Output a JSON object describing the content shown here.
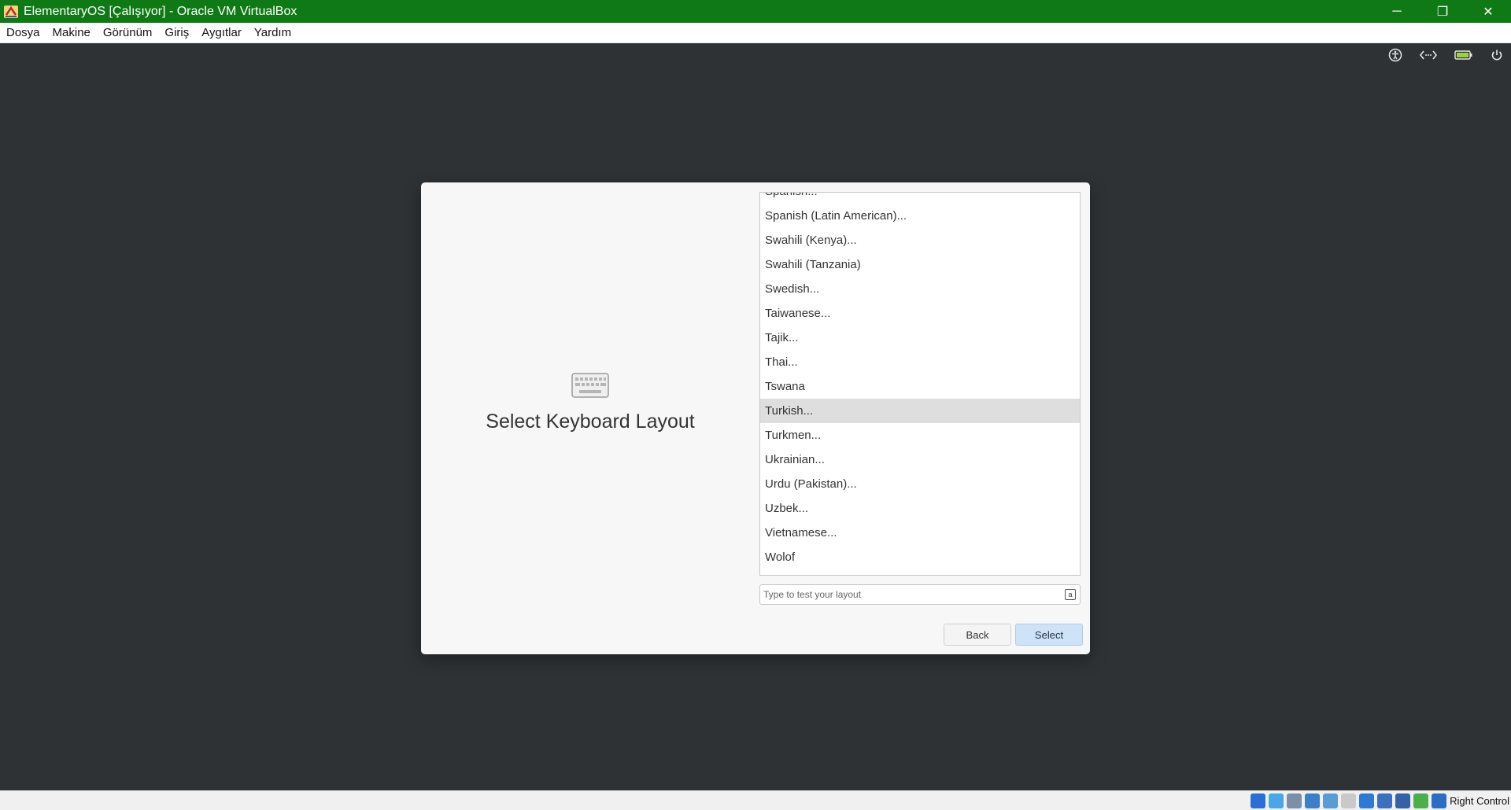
{
  "window": {
    "title": "ElementaryOS [Çalışıyor] - Oracle VM VirtualBox",
    "controls": {
      "minimize": "─",
      "restore": "❐",
      "close": "✕"
    }
  },
  "menu": {
    "items": [
      {
        "label": "Dosya"
      },
      {
        "label": "Makine"
      },
      {
        "label": "Görünüm"
      },
      {
        "label": "Giriş"
      },
      {
        "label": "Aygıtlar"
      },
      {
        "label": "Yardım"
      }
    ]
  },
  "guest_indicators": [
    "accessibility-icon",
    "network-icon",
    "battery-icon",
    "power-icon"
  ],
  "dialog": {
    "icon": "keyboard-icon",
    "title": "Select Keyboard Layout",
    "layouts": [
      {
        "label": "Spanish..."
      },
      {
        "label": "Spanish (Latin American)..."
      },
      {
        "label": "Swahili (Kenya)..."
      },
      {
        "label": "Swahili (Tanzania)"
      },
      {
        "label": "Swedish..."
      },
      {
        "label": "Taiwanese..."
      },
      {
        "label": "Tajik..."
      },
      {
        "label": "Thai..."
      },
      {
        "label": "Tswana"
      },
      {
        "label": "Turkish...",
        "selected": true
      },
      {
        "label": "Turkmen..."
      },
      {
        "label": "Ukrainian..."
      },
      {
        "label": "Urdu (Pakistan)..."
      },
      {
        "label": "Uzbek..."
      },
      {
        "label": "Vietnamese..."
      },
      {
        "label": "Wolof"
      }
    ],
    "test_input": {
      "placeholder": "Type to test your layout",
      "value": ""
    },
    "back_label": "Back",
    "select_label": "Select"
  },
  "statusbar": {
    "icons": [
      {
        "name": "hard-disk-icon",
        "color": "#2a6fd6"
      },
      {
        "name": "optical-drive-icon",
        "color": "#4aa6e6"
      },
      {
        "name": "audio-icon",
        "color": "#7b8fa8"
      },
      {
        "name": "network-adapter-icon",
        "color": "#3d7ec9"
      },
      {
        "name": "usb-icon",
        "color": "#5b9bd5"
      },
      {
        "name": "shared-folders-icon",
        "color": "#c9c9c9"
      },
      {
        "name": "display-icon",
        "color": "#2e79d4"
      },
      {
        "name": "recording-icon",
        "color": "#3b6fc2"
      },
      {
        "name": "vt-x-icon",
        "color": "#3561a8"
      },
      {
        "name": "guest-additions-icon",
        "color": "#4bb04b"
      },
      {
        "name": "mouse-integration-icon",
        "color": "#2c6dc4"
      }
    ],
    "host_key": "Right Control"
  },
  "colors": {
    "titlebar": "#0f7a15",
    "desktop": "#2e3235",
    "dialog_bg": "#f7f7f7",
    "selected_row": "#dedede",
    "select_button": "#cfe3f8"
  }
}
